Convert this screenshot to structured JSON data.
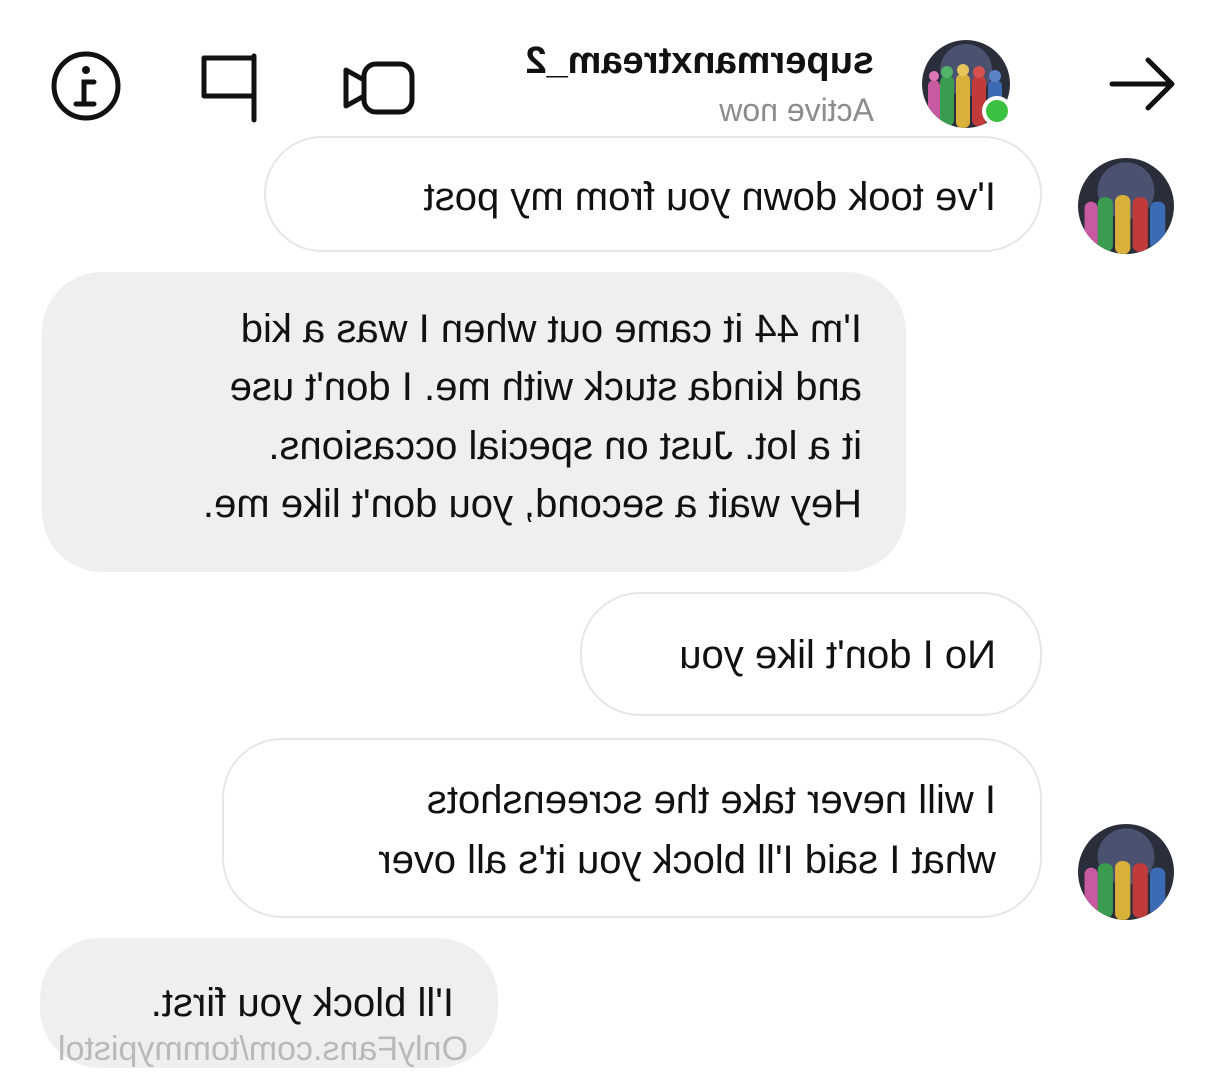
{
  "header": {
    "username": "supermanxtream_2",
    "status": "Active now",
    "icons": {
      "back": "back-arrow-icon",
      "video": "video-call-icon",
      "flag": "flag-icon",
      "info": "info-icon"
    },
    "online_color": "#3bc142"
  },
  "messages": [
    {
      "sender": "them",
      "text": "I've took down you from my post"
    },
    {
      "sender": "me",
      "lines": [
        "I'm 44 it came out when I was a kid",
        "and kinda stuck with me. I don't use",
        "it a lot. Just on special occasions.",
        "Hey wait a second, you don't like me."
      ]
    },
    {
      "sender": "them",
      "text": "No I don't like you"
    },
    {
      "sender": "them",
      "lines": [
        "I will never take the screenshots",
        "what I said I'll block you it's all over"
      ]
    },
    {
      "sender": "me",
      "text": "I'll block you first."
    }
  ],
  "watermark": "OnlyFans.com/tommypistol",
  "colors": {
    "my_bubble": "#efefef",
    "their_bubble_border": "#e6e6e6",
    "muted_text": "#8c8c8c"
  }
}
